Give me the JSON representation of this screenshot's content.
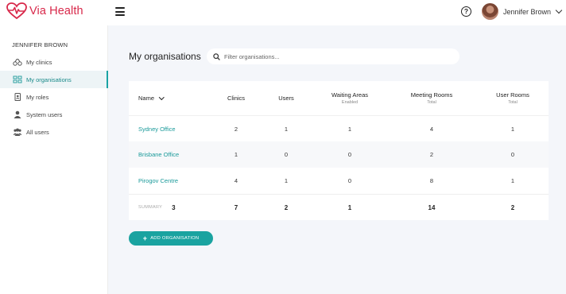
{
  "app": {
    "name": "Via Health"
  },
  "user": {
    "name": "Jennifer Brown",
    "sidebar_name": "JENNIFER BROWN"
  },
  "sidebar": {
    "items": [
      {
        "label": "My clinics",
        "icon": "stethoscope-icon",
        "active": false
      },
      {
        "label": "My organisations",
        "icon": "organisation-icon",
        "active": true
      },
      {
        "label": "My roles",
        "icon": "badge-icon",
        "active": false
      },
      {
        "label": "System users",
        "icon": "user-icon",
        "active": false
      },
      {
        "label": "All users",
        "icon": "users-icon",
        "active": false
      }
    ]
  },
  "main": {
    "title": "My organisations",
    "search_placeholder": "Filter organisations...",
    "columns": [
      {
        "label": "Name",
        "sub": ""
      },
      {
        "label": "Clinics",
        "sub": ""
      },
      {
        "label": "Users",
        "sub": ""
      },
      {
        "label": "Waiting Areas",
        "sub": "Enabled"
      },
      {
        "label": "Meeting Rooms",
        "sub": "Total"
      },
      {
        "label": "User Rooms",
        "sub": "Total"
      }
    ],
    "rows": [
      {
        "name": "Sydney Office",
        "clinics": "2",
        "users": "1",
        "waiting": "1",
        "meeting": "4",
        "user_rooms": "1"
      },
      {
        "name": "Brisbane Office",
        "clinics": "1",
        "users": "0",
        "waiting": "0",
        "meeting": "2",
        "user_rooms": "0"
      },
      {
        "name": "Pirogov Centre",
        "clinics": "4",
        "users": "1",
        "waiting": "0",
        "meeting": "8",
        "user_rooms": "1"
      }
    ],
    "summary": {
      "label": "SUMMARY",
      "count": "3",
      "clinics": "7",
      "users": "2",
      "waiting": "1",
      "meeting": "14",
      "user_rooms": "2"
    },
    "add_button": "ADD ORGANISATION"
  },
  "colors": {
    "brand": "#d8284a",
    "accent": "#1aa3a0"
  }
}
